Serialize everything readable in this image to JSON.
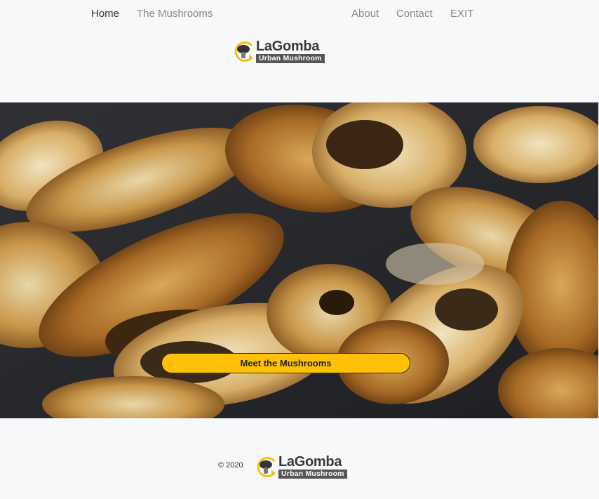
{
  "nav": {
    "home": "Home",
    "mushrooms": "The Mushrooms",
    "about": "About",
    "contact": "Contact",
    "exit": "EXIT"
  },
  "logo": {
    "name": "LaGomba",
    "tagline": "Urban Mushroom",
    "icon": "mushroom-logo-icon",
    "colors": {
      "ring": "#f4c20d",
      "cap": "#333333",
      "text": "#3a3a3a",
      "tag_bg": "#555555"
    }
  },
  "hero": {
    "image": "sauteed-mushrooms-photo",
    "cta_label": "Meet the Mushrooms",
    "cta_color": "#ffc107"
  },
  "footer": {
    "copyright": "© 2020"
  }
}
